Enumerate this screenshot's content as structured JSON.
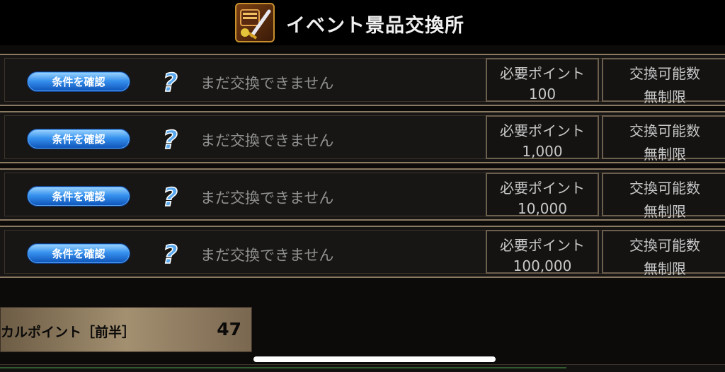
{
  "header": {
    "title": "イベント景品交換所",
    "icon": "event-exchange-icon"
  },
  "rows": [
    {
      "button_label": "条件を確認",
      "status": "まだ交換できません",
      "points_label": "必要ポイント",
      "points_value": "100",
      "limit_label": "交換可能数",
      "limit_value": "無制限"
    },
    {
      "button_label": "条件を確認",
      "status": "まだ交換できません",
      "points_label": "必要ポイント",
      "points_value": "1,000",
      "limit_label": "交換可能数",
      "limit_value": "無制限"
    },
    {
      "button_label": "条件を確認",
      "status": "まだ交換できません",
      "points_label": "必要ポイント",
      "points_value": "10,000",
      "limit_label": "交換可能数",
      "limit_value": "無制限"
    },
    {
      "button_label": "条件を確認",
      "status": "まだ交換できません",
      "points_label": "必要ポイント",
      "points_value": "100,000",
      "limit_label": "交換可能数",
      "limit_value": "無制限"
    }
  ],
  "footer": {
    "label": "カルポイント［前半］",
    "value": "47"
  },
  "colors": {
    "button_blue": "#2f86e8",
    "status_gray": "#909090",
    "frame_brown": "#8b7a62",
    "panel_tan": "#a39071"
  }
}
